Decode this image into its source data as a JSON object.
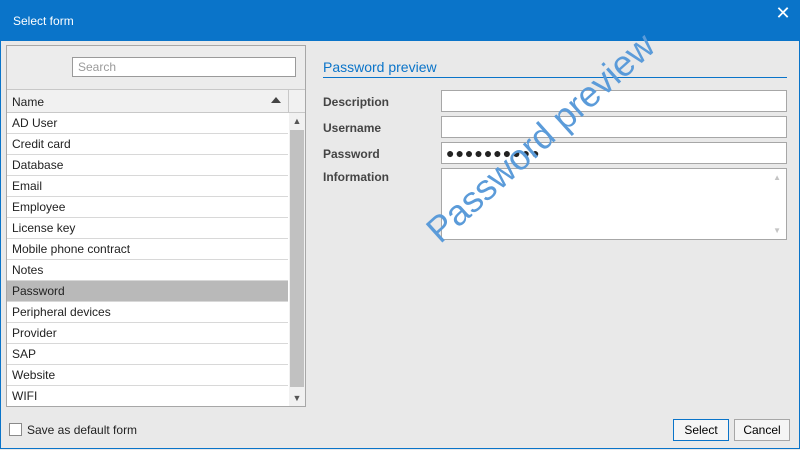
{
  "window": {
    "title": "Select form",
    "close_glyph": "✕"
  },
  "search": {
    "placeholder": "Search",
    "value": ""
  },
  "list": {
    "column_header": "Name",
    "sort_direction": "ascending",
    "items": [
      "AD User",
      "Credit card",
      "Database",
      "Email",
      "Employee",
      "License key",
      "Mobile phone contract",
      "Notes",
      "Password",
      "Peripheral devices",
      "Provider",
      "SAP",
      "Website",
      "WIFI"
    ],
    "selected_index": 8
  },
  "preview": {
    "title": "Password preview",
    "fields": {
      "description": {
        "label": "Description",
        "value": ""
      },
      "username": {
        "label": "Username",
        "value": ""
      },
      "password": {
        "label": "Password",
        "value": "●●●●●●●●●●"
      },
      "information": {
        "label": "Information",
        "value": ""
      }
    },
    "watermark": "Password preview"
  },
  "footer": {
    "default_checkbox_label": "Save as default form",
    "default_checkbox_checked": false,
    "select_label": "Select",
    "cancel_label": "Cancel"
  },
  "colors": {
    "accent": "#0a74c9",
    "selection": "#b9b9b9",
    "watermark": "#5b9bd9"
  }
}
